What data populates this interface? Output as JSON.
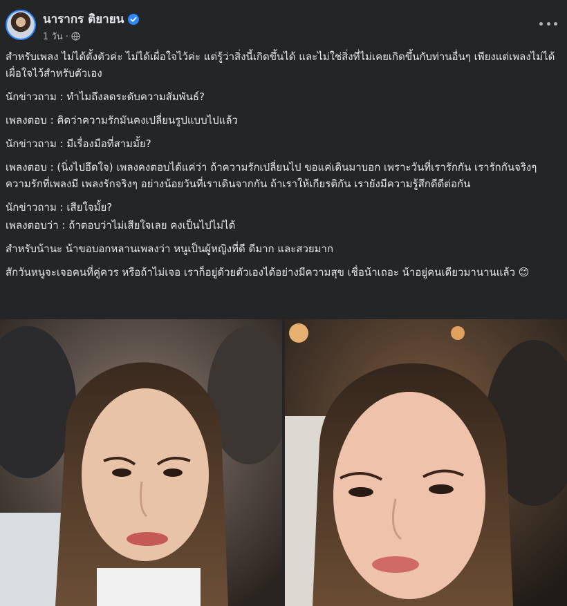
{
  "author": {
    "name": "นารากร ติยายน",
    "time": "1 วัน ·",
    "verified": true
  },
  "icons": {
    "verified": "verified-badge-icon",
    "audience": "globe-icon",
    "menu": "more-options-icon",
    "emoji": "smiling-face-emoji"
  },
  "colors": {
    "background": "#242526",
    "text": "#e4e6eb",
    "meta": "#b0b3b8",
    "verified": "#2d88ff"
  },
  "post": {
    "paragraphs": [
      "สำหรับเพลง ไม่ได้ตั้งตัวค่ะ ไม่ได้เผื่อใจไว้ค่ะ แต่รู้ว่าสิ่งนี้เกิดขึ้นได้ และไม่ใช่สิ่งที่ไม่เคยเกิดขึ้นกับท่านอื่นๆ เพียงแต่เพลงไม่ได้เผื่อใจไว้สำหรับตัวเอง",
      "นักข่าวถาม : ทำไมถึงลดระดับความสัมพันธ์?",
      "เพลงตอบ : คิดว่าความรักมันคงเปลี่ยนรูปแบบไปแล้ว",
      "นักข่าวถาม : มีเรื่องมือที่สามมั้ย?",
      "เพลงตอบ : (นิ่งไปอึดใจ) เพลงคงตอบได้แค่ว่า ถ้าความรักเปลี่ยนไป ขอแค่เดินมาบอก  เพราะวันที่เรารักกัน เรารักกันจริงๆ  ความรักที่เพลงมี เพลงรักจริงๆ อย่างน้อยวันที่เราเดินจากกัน ถ้าเราให้เกียรติกัน เรายังมีความรู้สึกดีดีต่อกัน",
      "นักข่าวถาม : เสียใจมั้ย?",
      "เพลงตอบว่า : ถ้าตอบว่าไม่เสียใจเลย คงเป็นไปไม่ได้",
      "สำหรับน้านะ น้าขอบอกหลานเพลงว่า หนูเป็นผู้หญิงที่ดี ดีมาก และสวยมาก",
      "สักวันหนูจะเจอคนที่คู่ควร  หรือถ้าไม่เจอ  เราก็อยู่ด้วยตัวเองได้อย่างมีความสุข เชื่อน้าเถอะ  น้าอยู่คนเดียวมานานแล้ว 😊"
    ]
  }
}
